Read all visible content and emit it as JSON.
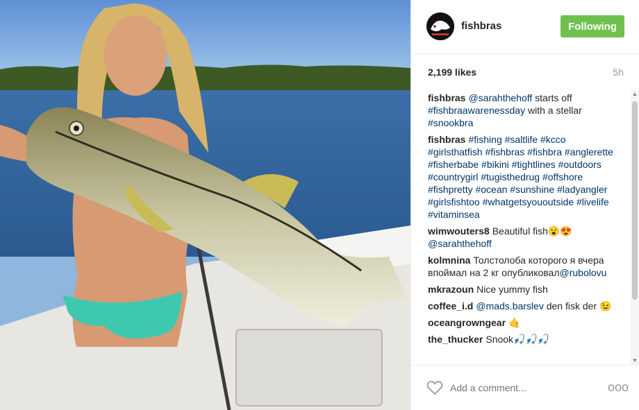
{
  "post": {
    "username": "fishbras",
    "follow_label": "Following",
    "likes": "2,199 likes",
    "time": "5h",
    "caption": {
      "user": "fishbras",
      "mention": "@sarahthehoff",
      "text": " starts off ",
      "tag1": "#fishbraawarenessday",
      "text2": " with a stellar ",
      "tag2": "#snookbra"
    },
    "hashtags": {
      "user": "fishbras",
      "text": "#fishing #saltlife #kcco #girlsthatfish #fishbras #fishbra #anglerette #fisherbabe #bikini #tightlines #outdoors #countrygirl #tugisthedrug #offshore #fishpretty #ocean #sunshine #ladyangler #girlsfishtoo #whatgetsyououtside #livelife #vitaminsea"
    },
    "comments": [
      {
        "user": "wimwouters8",
        "text": "Beautiful fish😮😍",
        "mention": "@sarahthehoff"
      },
      {
        "user": "kolmnina",
        "text": "Толстолоба которого я вчера впоймал на 2 кг опубликовал",
        "mention": "@rubolovu"
      },
      {
        "user": "mkrazoun",
        "text": "Nice yummy fish",
        "mention": ""
      },
      {
        "user": "coffee_i.d",
        "text": "den fisk der 😉",
        "mention": "@mads.barslev"
      },
      {
        "user": "oceangrowngear",
        "text": "🤙",
        "mention": ""
      },
      {
        "user": "the_thucker",
        "text": "Snook🎣🎣🎣",
        "mention": ""
      }
    ],
    "add_comment_placeholder": "Add a comment...",
    "more_label": "ooo"
  },
  "icons": {
    "like": "heart-icon",
    "options": "more-options-icon",
    "avatar": "fishbras-logo"
  },
  "colors": {
    "follow_button": "#70c050",
    "hashtag": "#003569",
    "muted": "#999999"
  }
}
